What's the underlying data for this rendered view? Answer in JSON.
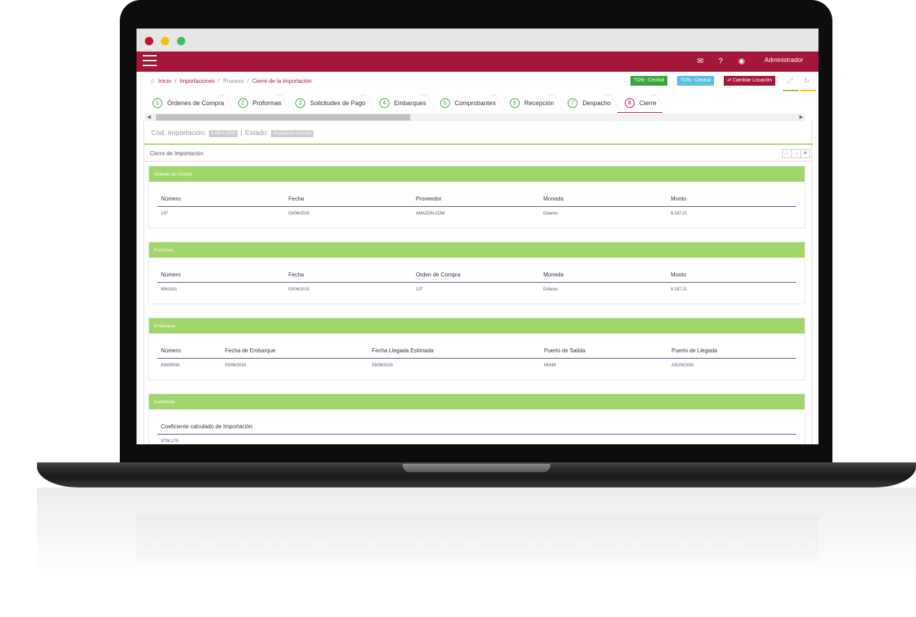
{
  "topnav": {
    "user": "Administrador"
  },
  "breadcrumb": {
    "home": "Inicio",
    "importaciones": "Importaciones",
    "proceso": "Proceso",
    "current": "Cierre de la Importación"
  },
  "location_badges": {
    "green": "TDN - Central",
    "blue": "TDN - Central",
    "change": "Cambiar Locación"
  },
  "steps": [
    {
      "num": "1",
      "label": "Órdenes de Compra"
    },
    {
      "num": "2",
      "label": "Proformas"
    },
    {
      "num": "3",
      "label": "Solicitudes de Pago"
    },
    {
      "num": "4",
      "label": "Embarques"
    },
    {
      "num": "5",
      "label": "Comprobantes"
    },
    {
      "num": "6",
      "label": "Recepción"
    },
    {
      "num": "7",
      "label": "Despacho"
    },
    {
      "num": "8",
      "label": "Cierre"
    }
  ],
  "info": {
    "cod_label": "Cód. Importación:",
    "cod_value": "3-AM-1-2015",
    "sep": "|",
    "estado_label": "Estado:",
    "estado_value": "Importación Cerrada"
  },
  "panel_title": "Cierre de Importación",
  "ordenes": {
    "title": "Órdenes de Compra",
    "headers": [
      "Número",
      "Fecha",
      "Proveedor",
      "Moneda",
      "Monto"
    ],
    "rows": [
      [
        "137",
        "03/06/2015",
        "AMAZON.COM",
        "Dólares",
        "8.187,21"
      ]
    ]
  },
  "proformas": {
    "title": "Proformas",
    "headers": [
      "Número",
      "Fecha",
      "Orden de Compra",
      "Moneda",
      "Monto"
    ],
    "rows": [
      [
        "6941831",
        "03/06/2015",
        "137",
        "Dólares",
        "8.187,21"
      ]
    ]
  },
  "embarques": {
    "title": "Embarques",
    "headers": [
      "Número",
      "Fecha de Embarque",
      "Fecha Llegada Estimada",
      "Puerto de Salida",
      "Puerto de Llegada"
    ],
    "rows": [
      [
        "83435036",
        "03/06/2015",
        "03/06/2015",
        "MIAMI",
        "ASUNCION"
      ]
    ]
  },
  "coeficiente": {
    "title": "Coeficiente",
    "headers": [
      "Coeficiente calculado de Importación"
    ],
    "rows": [
      [
        "5706,175"
      ]
    ]
  }
}
